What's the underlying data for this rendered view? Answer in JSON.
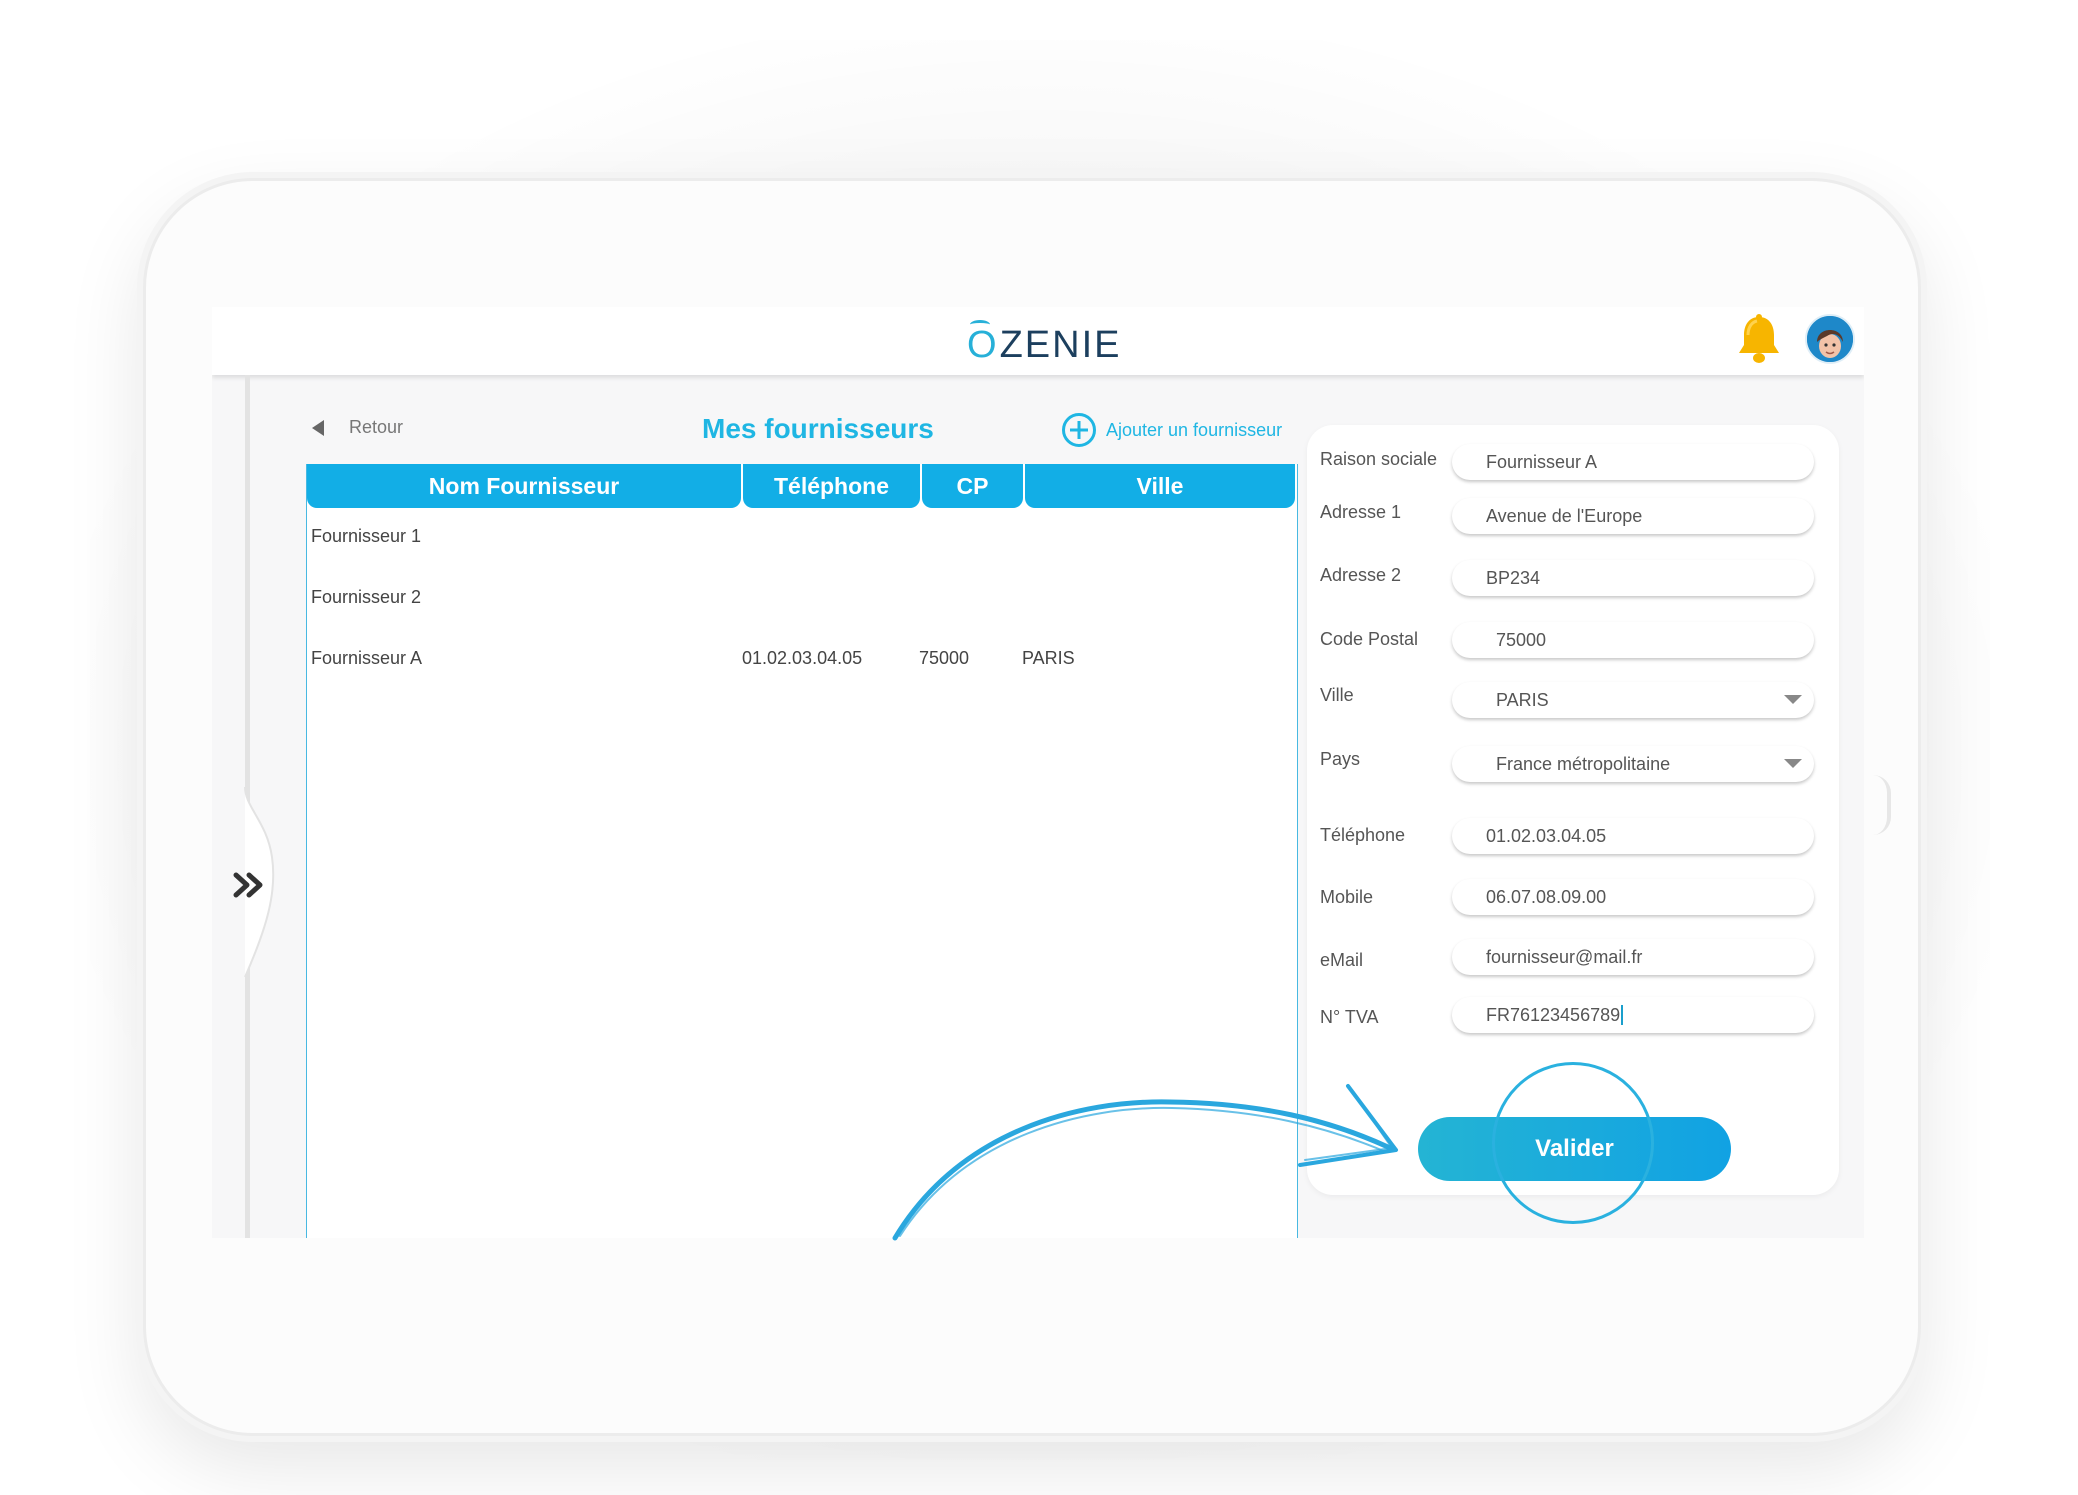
{
  "app": {
    "logo_letter": "O",
    "logo_rest": "ZENIE"
  },
  "nav": {
    "back_label": "Retour"
  },
  "page": {
    "title": "Mes fournisseurs",
    "add_label": "Ajouter un fournisseur"
  },
  "table": {
    "headers": [
      "Nom Fournisseur",
      "Téléphone",
      "CP",
      "Ville"
    ],
    "rows": [
      {
        "nom": "Fournisseur 1",
        "telephone": "",
        "cp": "",
        "ville": ""
      },
      {
        "nom": "Fournisseur 2",
        "telephone": "",
        "cp": "",
        "ville": ""
      },
      {
        "nom": "Fournisseur A",
        "telephone": "01.02.03.04.05",
        "cp": "75000",
        "ville": "PARIS"
      }
    ]
  },
  "form": {
    "raison_sociale": {
      "label": "Raison sociale",
      "value": "Fournisseur A"
    },
    "adresse1": {
      "label": "Adresse 1",
      "value": "Avenue de l'Europe"
    },
    "adresse2": {
      "label": "Adresse 2",
      "value": "BP234"
    },
    "code_postal": {
      "label": "Code Postal",
      "value": "75000"
    },
    "ville": {
      "label": "Ville",
      "value": "PARIS"
    },
    "pays": {
      "label": "Pays",
      "value": "France métropolitaine"
    },
    "telephone": {
      "label": "Téléphone",
      "value": "01.02.03.04.05"
    },
    "mobile": {
      "label": "Mobile",
      "value": "06.07.08.09.00"
    },
    "email": {
      "label": "eMail",
      "value": "fournisseur@mail.fr"
    },
    "tva": {
      "label": "N° TVA",
      "value": "FR76123456789"
    },
    "submit_label": "Valider"
  },
  "icons": {
    "bell": "bell-icon",
    "avatar": "user-avatar",
    "drawer": "double-chevron-right-icon",
    "back": "triangle-left-icon",
    "add": "plus-circle-icon"
  },
  "colors": {
    "accent": "#1fb6e3",
    "header_bg": "#12aee6",
    "logo_text": "#1c3f5e",
    "bell": "#f7b500"
  }
}
